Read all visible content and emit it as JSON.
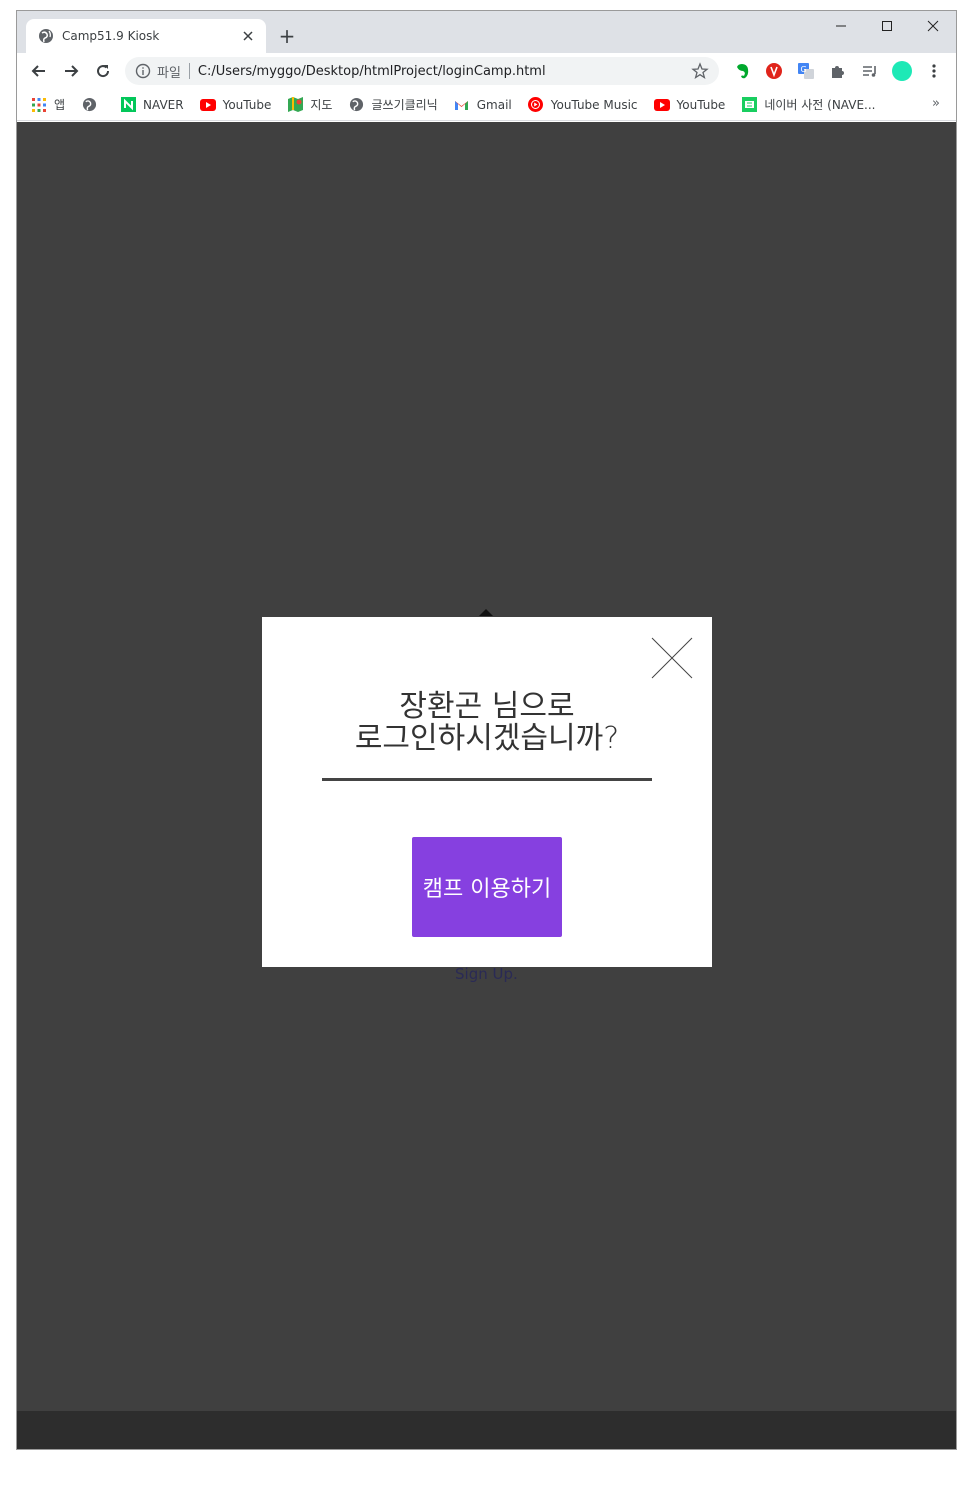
{
  "browser": {
    "tab": {
      "title": "Camp51.9 Kiosk",
      "favicon": "globe-icon"
    },
    "new_tab_label": "+",
    "omnibox": {
      "scheme_label": "파일",
      "url": "C:/Users/myggo/Desktop/htmlProject/loginCamp.html"
    },
    "bookmarks": [
      {
        "label": "앱",
        "icon": "apps-grid-icon"
      },
      {
        "label": "",
        "icon": "globe-icon"
      },
      {
        "label": "NAVER",
        "icon": "naver-icon"
      },
      {
        "label": "YouTube",
        "icon": "youtube-icon"
      },
      {
        "label": "지도",
        "icon": "maps-icon"
      },
      {
        "label": "글쓰기클리닉",
        "icon": "globe-icon"
      },
      {
        "label": "Gmail",
        "icon": "gmail-icon"
      },
      {
        "label": "YouTube Music",
        "icon": "youtube-music-icon"
      },
      {
        "label": "YouTube",
        "icon": "youtube-icon"
      },
      {
        "label": "네이버 사전 (NAVE...",
        "icon": "naver-dictionary-icon"
      }
    ],
    "bookmarks_overflow": "»",
    "colors": {
      "tabstrip": "#dee1e6",
      "omnibox": "#f1f3f4",
      "profile": "#1de9b6"
    }
  },
  "page": {
    "background_color": "#404040",
    "behind_text": "Sign Up.",
    "modal": {
      "message_line1": "장환곤 님으로",
      "message_line2": "로그인하시겠습니까?",
      "button_label": "캠프 이용하기",
      "button_color": "#8640e0",
      "close_icon": "close-x-icon"
    }
  }
}
